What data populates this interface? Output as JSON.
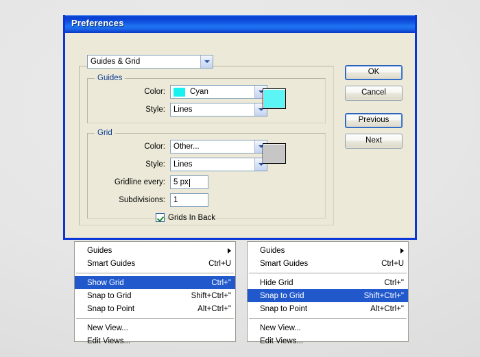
{
  "dialog": {
    "title": "Preferences",
    "section_select": {
      "value": "Guides & Grid"
    },
    "guides": {
      "legend": "Guides",
      "color_label": "Color:",
      "color_value": "Cyan",
      "color_hex": "#19f0f0",
      "style_label": "Style:",
      "style_value": "Lines",
      "swatch_hex": "#5cf5f5"
    },
    "grid": {
      "legend": "Grid",
      "color_label": "Color:",
      "color_value": "Other...",
      "style_label": "Style:",
      "style_value": "Lines",
      "gridline_label": "Gridline every:",
      "gridline_value": "5 px",
      "subdivisions_label": "Subdivisions:",
      "subdivisions_value": "1",
      "grids_in_back_label": "Grids In Back",
      "grids_in_back_checked": true,
      "swatch_hex": "#c6c6c6"
    },
    "buttons": {
      "ok": "OK",
      "cancel": "Cancel",
      "previous": "Previous",
      "next": "Next"
    }
  },
  "menu_left": {
    "items": [
      {
        "label": "Guides",
        "accel": "",
        "arrow": true,
        "selected": false
      },
      {
        "label": "Smart Guides",
        "accel": "Ctrl+U",
        "arrow": false,
        "selected": false
      },
      {
        "separator": true
      },
      {
        "label": "Show Grid",
        "accel": "Ctrl+\"",
        "arrow": false,
        "selected": true
      },
      {
        "label": "Snap to Grid",
        "accel": "Shift+Ctrl+\"",
        "arrow": false,
        "selected": false
      },
      {
        "label": "Snap to Point",
        "accel": "Alt+Ctrl+\"",
        "arrow": false,
        "selected": false
      },
      {
        "separator": true
      },
      {
        "label": "New View...",
        "accel": "",
        "arrow": false,
        "selected": false
      },
      {
        "label": "Edit Views...",
        "accel": "",
        "arrow": false,
        "selected": false
      }
    ]
  },
  "menu_right": {
    "items": [
      {
        "label": "Guides",
        "accel": "",
        "arrow": true,
        "selected": false
      },
      {
        "label": "Smart Guides",
        "accel": "Ctrl+U",
        "arrow": false,
        "selected": false
      },
      {
        "separator": true
      },
      {
        "label": "Hide Grid",
        "accel": "Ctrl+\"",
        "arrow": false,
        "selected": false
      },
      {
        "label": "Snap to Grid",
        "accel": "Shift+Ctrl+\"",
        "arrow": false,
        "selected": true
      },
      {
        "label": "Snap to Point",
        "accel": "Alt+Ctrl+\"",
        "arrow": false,
        "selected": false
      },
      {
        "separator": true
      },
      {
        "label": "New View...",
        "accel": "",
        "arrow": false,
        "selected": false
      },
      {
        "label": "Edit Views...",
        "accel": "",
        "arrow": false,
        "selected": false
      }
    ]
  },
  "theme": {
    "title_blue": "#0a3fd2",
    "dialog_face": "#ece9d8",
    "selection_blue": "#2159cd",
    "legend_blue": "#0a3d91"
  }
}
